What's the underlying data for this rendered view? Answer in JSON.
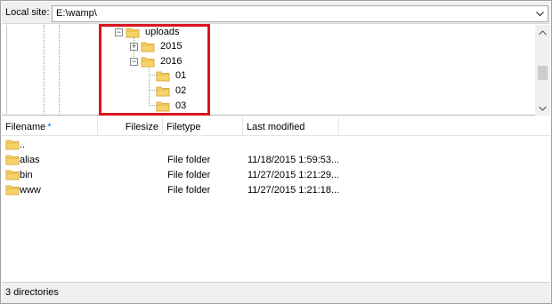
{
  "local_site": {
    "label": "Local site:",
    "path": "E:\\wamp\\"
  },
  "tree": {
    "nodes": [
      {
        "label": "uploads",
        "expander": "−"
      },
      {
        "label": "2015",
        "expander": "+"
      },
      {
        "label": "2016",
        "expander": "−"
      },
      {
        "label": "01"
      },
      {
        "label": "02"
      },
      {
        "label": "03"
      }
    ]
  },
  "file_list": {
    "columns": [
      "Filename",
      "Filesize",
      "Filetype",
      "Last modified"
    ],
    "sort_indicator": "▲",
    "rows": [
      {
        "name": "..",
        "size": "",
        "type": "",
        "modified": ""
      },
      {
        "name": "alias",
        "size": "",
        "type": "File folder",
        "modified": "11/18/2015 1:59:53..."
      },
      {
        "name": "bin",
        "size": "",
        "type": "File folder",
        "modified": "11/27/2015 1:21:29..."
      },
      {
        "name": "www",
        "size": "",
        "type": "File folder",
        "modified": "11/27/2015 1:21:18..."
      }
    ]
  },
  "status": {
    "text": "3 directories"
  },
  "colors": {
    "highlight_border": "#d9141e",
    "folder_fill": "#f6d36a",
    "folder_dark": "#dcae3f",
    "panel_bg": "#f0f0f0"
  },
  "icons": [
    "folder-icon",
    "chevron-down-icon",
    "scroll-up-icon",
    "scroll-down-icon",
    "expand-icon",
    "collapse-icon"
  ]
}
